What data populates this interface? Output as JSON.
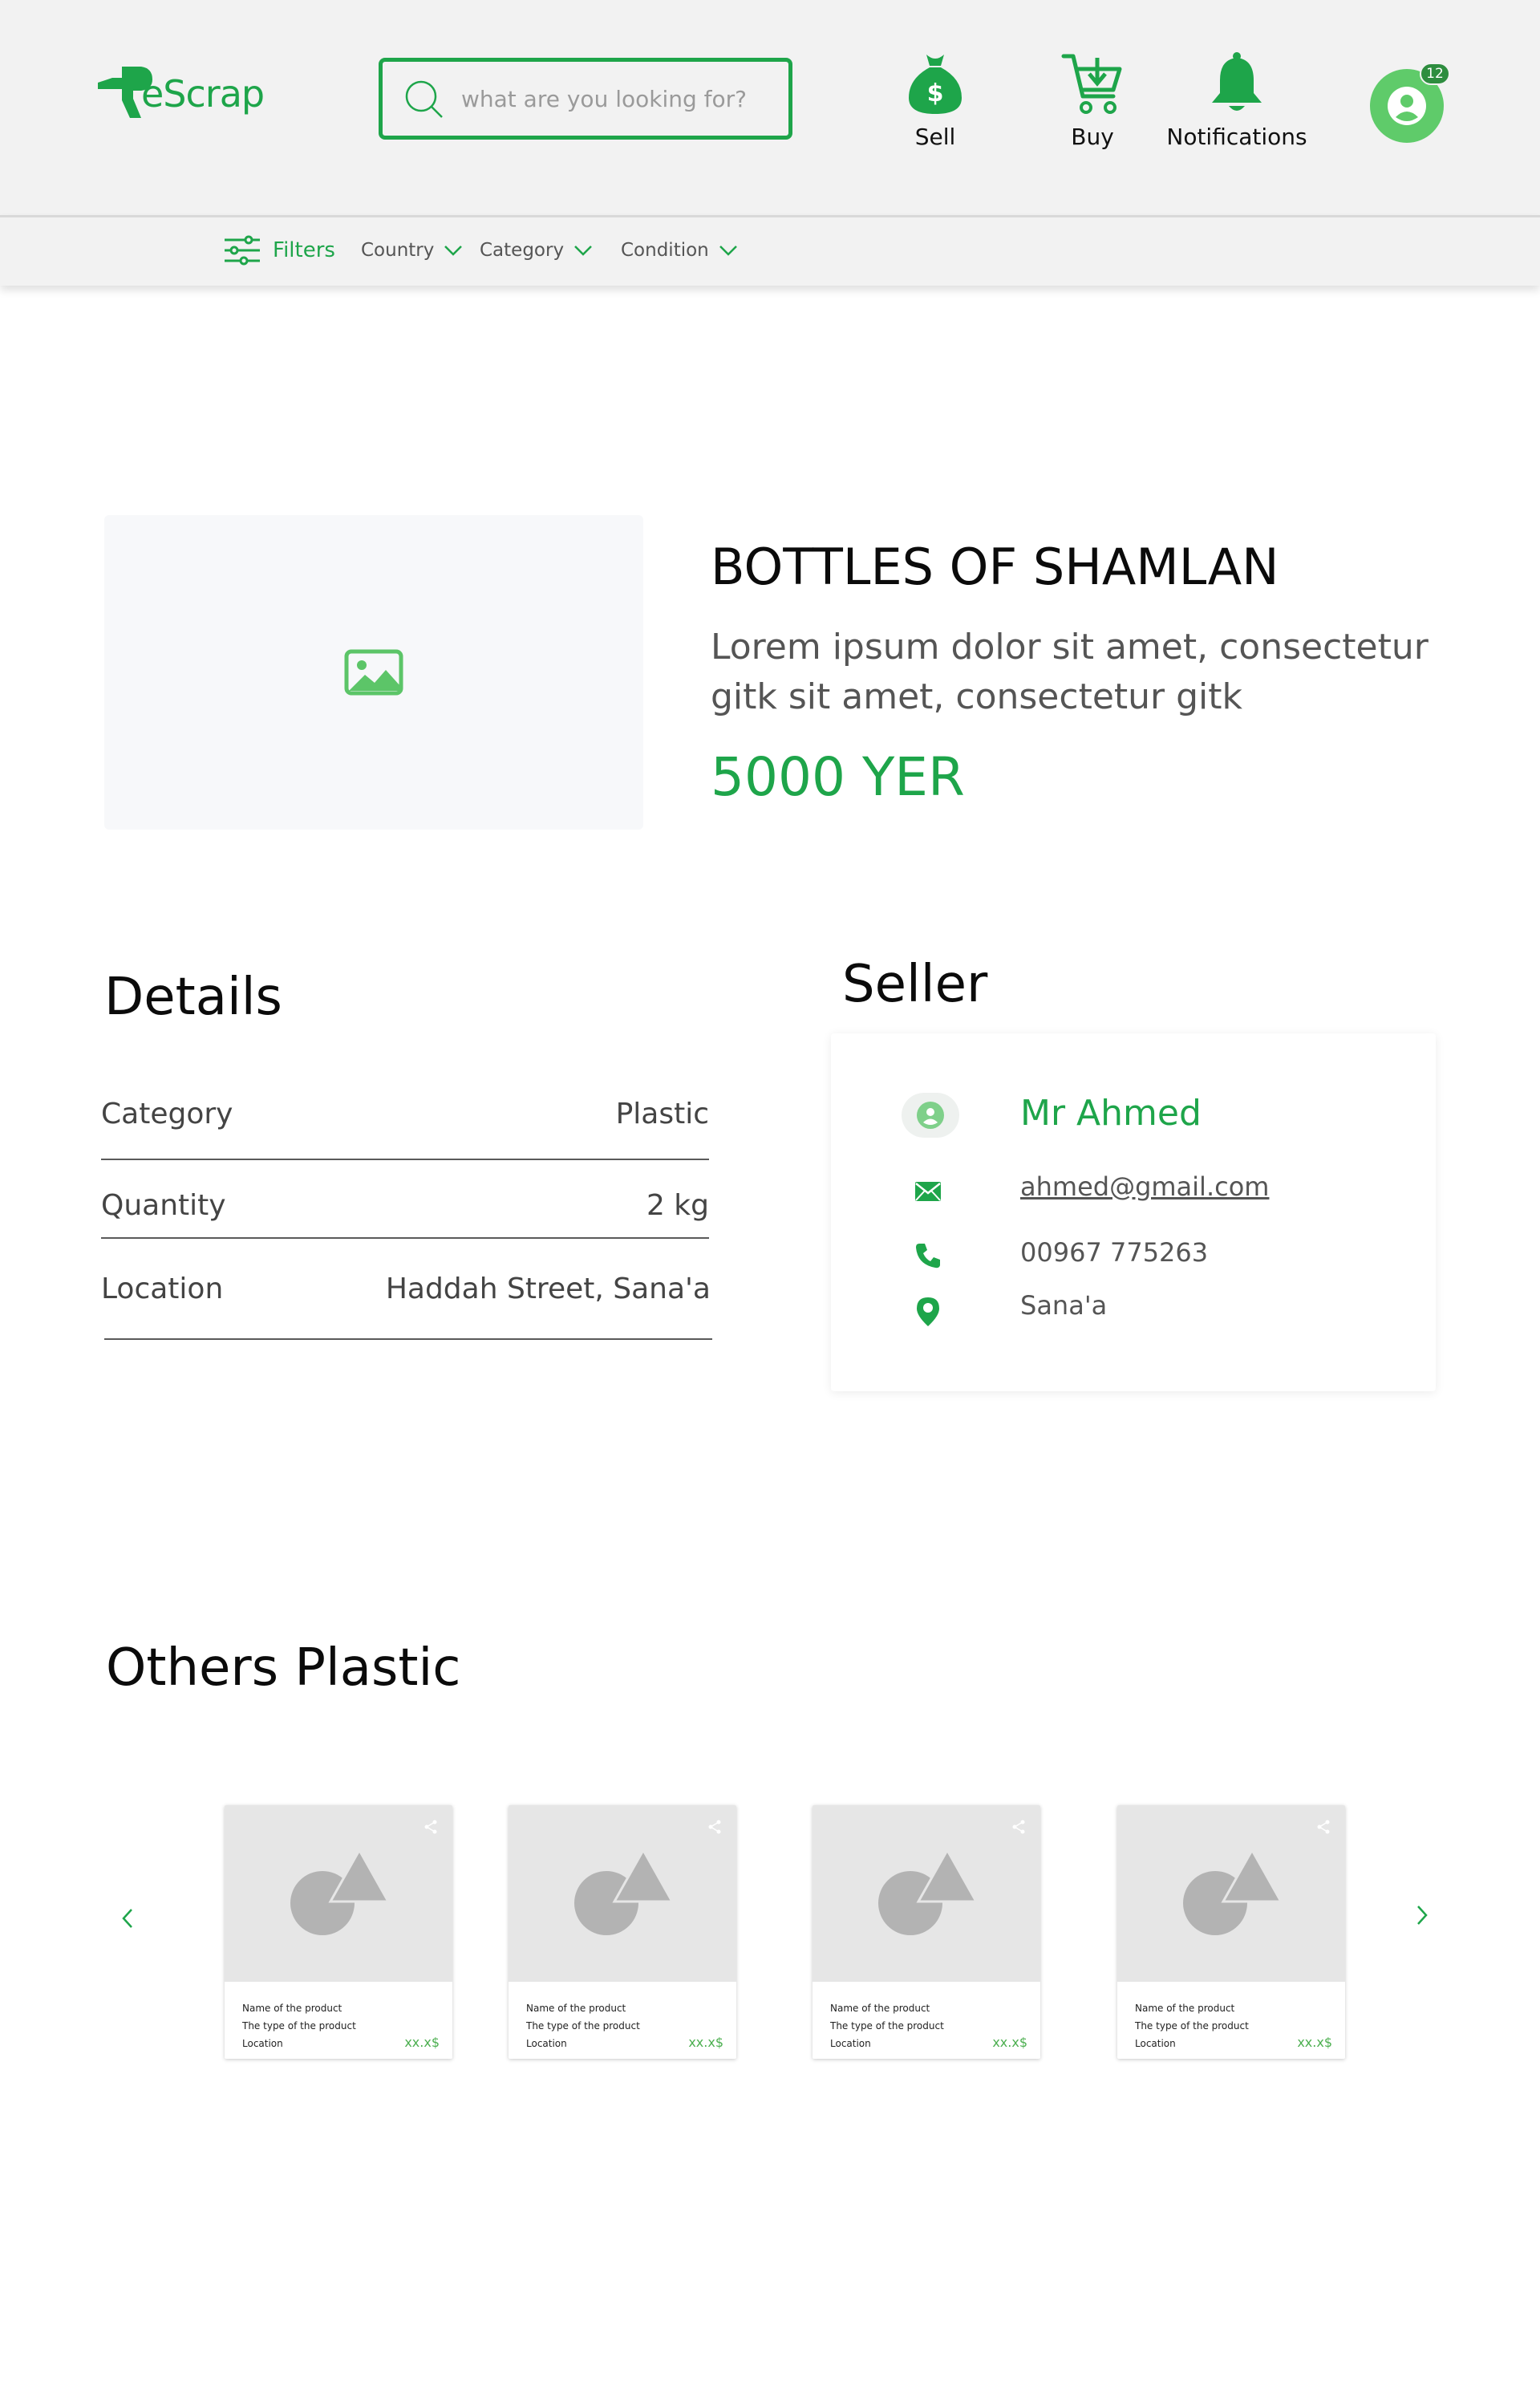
{
  "brand": {
    "name": "eScrap",
    "color": "#1ea54a"
  },
  "search": {
    "placeholder": "what are you looking for?"
  },
  "nav": {
    "sell": "Sell",
    "buy": "Buy",
    "notifications": "Notifications",
    "badge_count": "12"
  },
  "filters": {
    "label": "Filters",
    "dropdowns": [
      "Country",
      "Category",
      "Condition"
    ]
  },
  "product": {
    "title": "BOTTLES OF SHAMLAN",
    "description": "Lorem ipsum dolor sit amet, consectetur gitk sit amet, consectetur gitk",
    "price": "5000 YER"
  },
  "details": {
    "title": "Details",
    "rows": [
      {
        "label": "Category",
        "value": "Plastic"
      },
      {
        "label": "Quantity",
        "value": "2 kg"
      },
      {
        "label": "Location",
        "value": "Haddah Street, Sana'a"
      }
    ]
  },
  "seller": {
    "title": "Seller",
    "name": "Mr Ahmed",
    "email": "ahmed@gmail.com",
    "phone": "00967 775263",
    "city": "Sana'a"
  },
  "others": {
    "title": "Others Plastic",
    "cards": [
      {
        "name": "Name of the product",
        "type": "The type of the product",
        "location": "Location",
        "price": "xx.x$"
      },
      {
        "name": "Name of the product",
        "type": "The type of the product",
        "location": "Location",
        "price": "xx.x$"
      },
      {
        "name": "Name of the product",
        "type": "The type of the product",
        "location": "Location",
        "price": "xx.x$"
      },
      {
        "name": "Name of the product",
        "type": "The type of the product",
        "location": "Location",
        "price": "xx.x$"
      }
    ]
  }
}
